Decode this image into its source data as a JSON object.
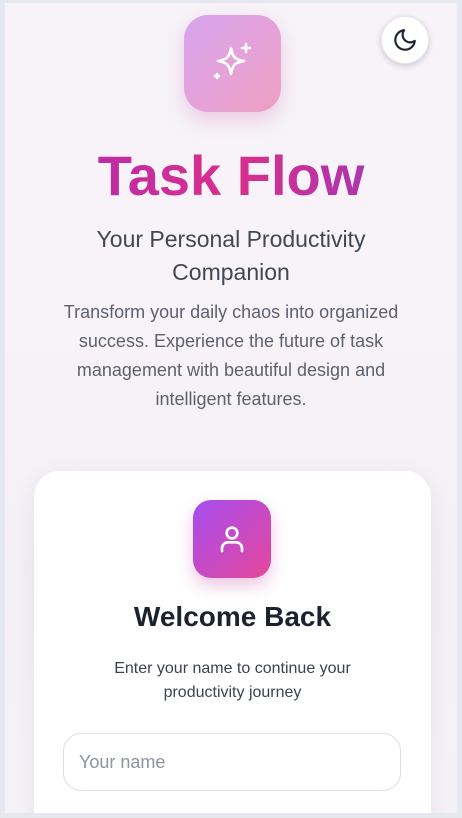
{
  "header": {
    "theme_toggle_icon": "moon-icon",
    "logo_icon": "sparkles-icon",
    "title": "Task Flow",
    "subtitle": "Your Personal Productivity Companion",
    "description": "Transform your daily chaos into organized success. Experience the future of task management with beautiful design and intelligent features."
  },
  "login_card": {
    "icon": "user-icon",
    "title": "Welcome Back",
    "subtitle": "Enter your name to continue your productivity journey",
    "name_input": {
      "value": "",
      "placeholder": "Your name"
    }
  },
  "colors": {
    "title_gradient": [
      "#a62bba",
      "#db2f8a",
      "#8e37c8"
    ],
    "logo_gradient": [
      "#d7a4ee",
      "#eea0c2"
    ],
    "user_badge_gradient": [
      "#a54cf0",
      "#e6489b"
    ],
    "page_background": "#f7f3f8",
    "card_background": "#ffffff"
  }
}
